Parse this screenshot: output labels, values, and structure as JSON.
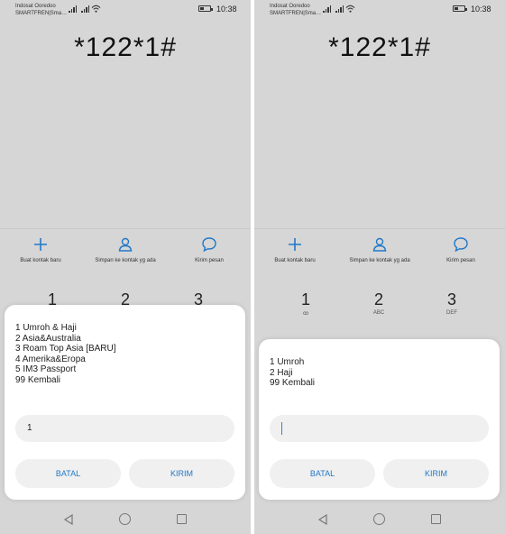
{
  "screens": [
    {
      "status": {
        "carrier_line1": "Indosat Ooredoo",
        "carrier_line2": "SMARTFREN|Sma…",
        "time": "10:38"
      },
      "dialed": "*122*1#",
      "actions": [
        {
          "label": "Buat kontak baru",
          "icon": "plus-icon"
        },
        {
          "label": "Simpan ke kontak yg ada",
          "icon": "person-icon"
        },
        {
          "label": "Kirim pesan",
          "icon": "message-icon"
        }
      ],
      "keys": [
        {
          "num": "1",
          "sub": ""
        },
        {
          "num": "2",
          "sub": ""
        },
        {
          "num": "3",
          "sub": ""
        }
      ],
      "dialog": {
        "menu": [
          "1 Umroh & Haji",
          "2 Asia&Australia",
          "3 Roam Top Asia [BARU]",
          "4 Amerika&Eropa",
          "5 IM3 Passport",
          "99 Kembali"
        ],
        "input_value": "1",
        "cancel_label": "BATAL",
        "send_label": "KIRIM"
      }
    },
    {
      "status": {
        "carrier_line1": "Indosat Ooredoo",
        "carrier_line2": "SMARTFREN|Sma…",
        "time": "10:38"
      },
      "dialed": "*122*1#",
      "actions": [
        {
          "label": "Buat kontak baru",
          "icon": "plus-icon"
        },
        {
          "label": "Simpan ke kontak yg ada",
          "icon": "person-icon"
        },
        {
          "label": "Kirim pesan",
          "icon": "message-icon"
        }
      ],
      "keys": [
        {
          "num": "1",
          "sub": "ꝏ"
        },
        {
          "num": "2",
          "sub": "ABC"
        },
        {
          "num": "3",
          "sub": "DEF"
        }
      ],
      "dialog": {
        "menu": [
          "1 Umroh",
          "2 Haji",
          "99 Kembali"
        ],
        "input_value": "",
        "cancel_label": "BATAL",
        "send_label": "KIRIM"
      }
    }
  ],
  "colors": {
    "accent": "#2278c8",
    "background": "#d6d6d6",
    "dialog": "#ffffff"
  }
}
